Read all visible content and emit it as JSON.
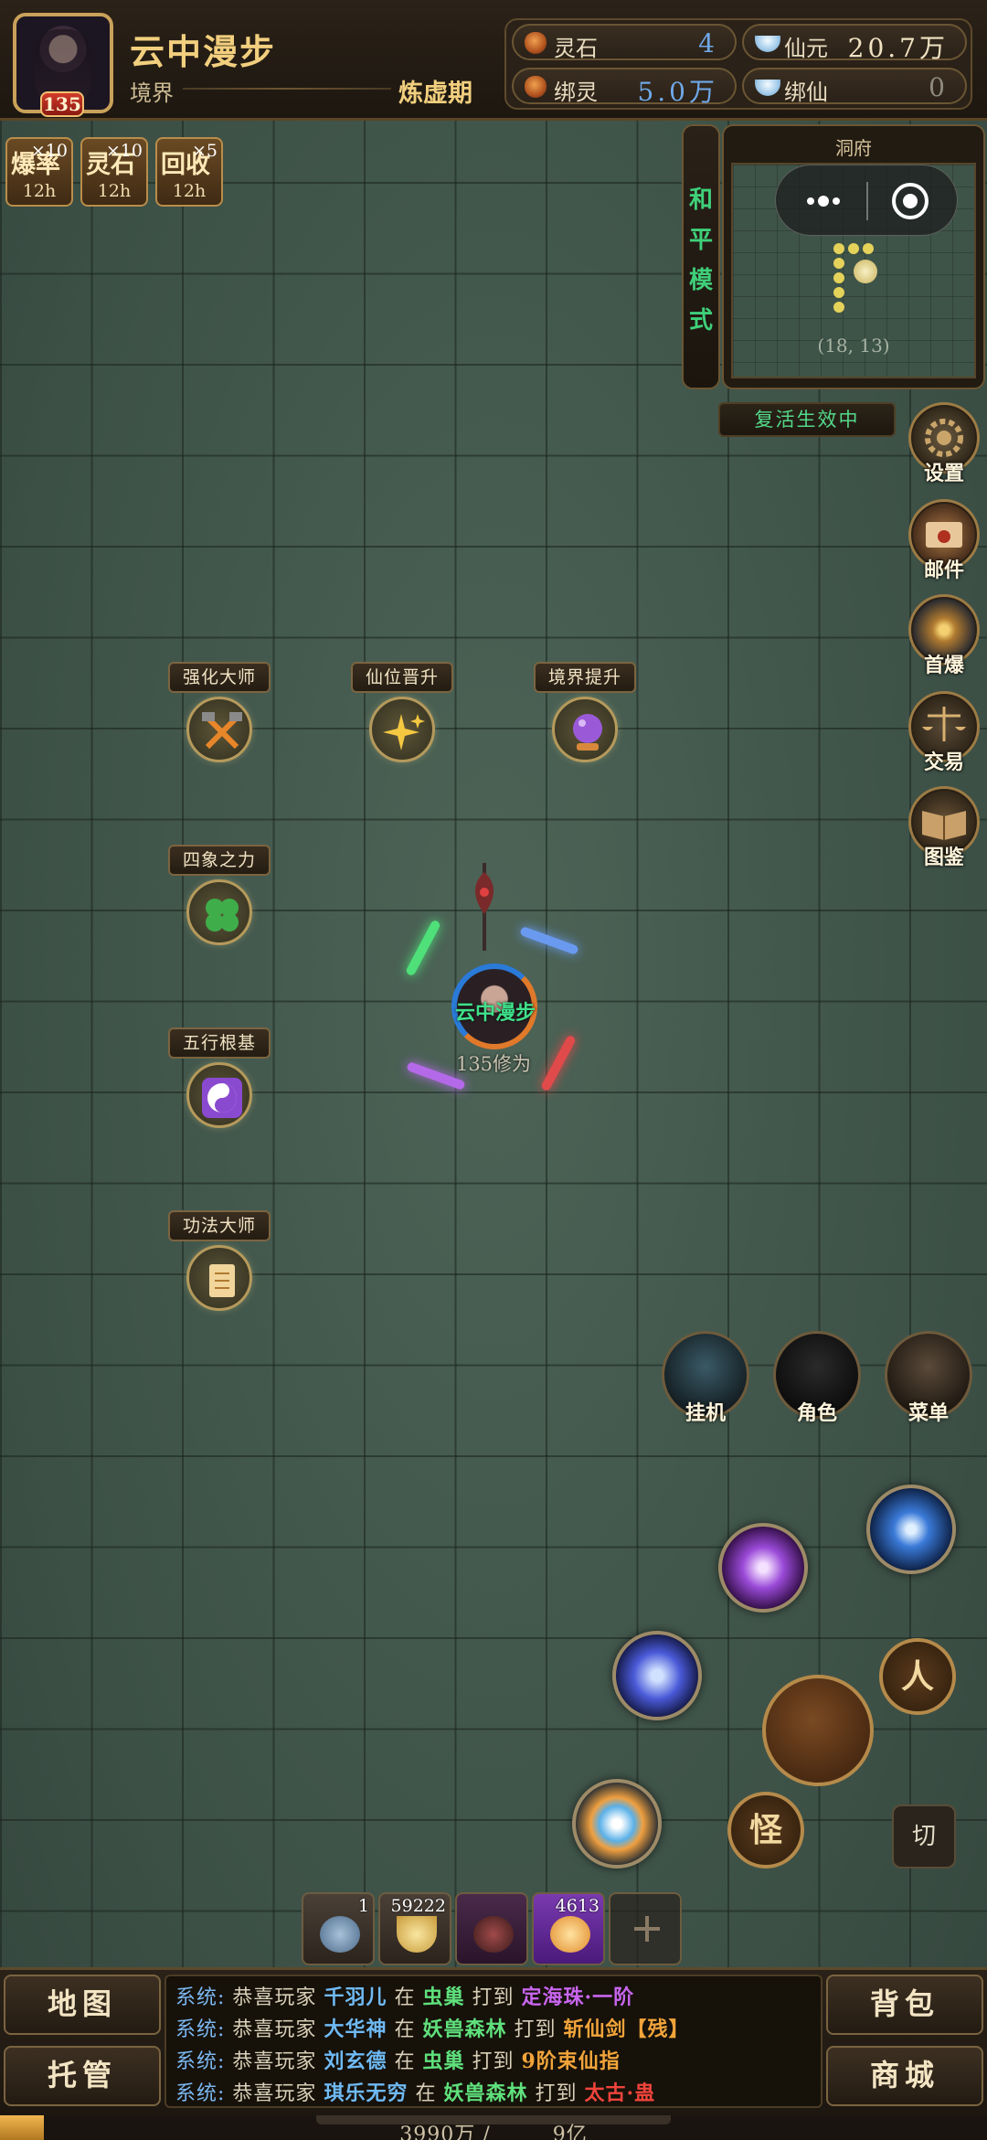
{
  "colors": {
    "accent_gold": "#f2cf7e",
    "peace_green": "#3fd07a",
    "chat_system_blue": "#7bb7f0",
    "player_name_green": "#3fe08a"
  },
  "header": {
    "player_name": "云中漫步",
    "level": "135",
    "realm_label": "境界",
    "realm_value": "炼虚期"
  },
  "currencies": [
    {
      "name": "灵石",
      "value": "4",
      "icon": "spirit-stone-icon",
      "value_color": "#6fa8e8"
    },
    {
      "name": "仙元",
      "value": "20.7万",
      "icon": "silver-ingot-icon",
      "value_color": "#f0e2c2"
    },
    {
      "name": "绑灵",
      "value": "5.0万",
      "icon": "spirit-stone-icon",
      "value_color": "#6fa8e8"
    },
    {
      "name": "绑仙",
      "value": "0",
      "icon": "silver-ingot-icon",
      "value_color": "#f0e2c2"
    }
  ],
  "buffs": [
    {
      "name": "爆率",
      "count": "×10",
      "time": "12h"
    },
    {
      "name": "灵石",
      "count": "×10",
      "time": "12h"
    },
    {
      "name": "回收",
      "count": "×5",
      "time": "12h"
    }
  ],
  "peace_mode": [
    "和",
    "平",
    "模",
    "式"
  ],
  "minimap": {
    "title": "洞府",
    "coords": "(18, 13)"
  },
  "revive_status": "复活生效中",
  "side_buttons": [
    "设置",
    "邮件",
    "首爆",
    "交易",
    "图鉴"
  ],
  "npcs": [
    {
      "label": "强化大师",
      "icon": "crossed-hammers-icon"
    },
    {
      "label": "仙位晋升",
      "icon": "sparkles-icon"
    },
    {
      "label": "境界提升",
      "icon": "crystal-ball-icon"
    },
    {
      "label": "四象之力",
      "icon": "four-leaf-clover-icon"
    },
    {
      "label": "五行根基",
      "icon": "yin-yang-icon"
    },
    {
      "label": "功法大师",
      "icon": "scroll-icon"
    }
  ],
  "player": {
    "name": "云中漫步",
    "power": "135修为"
  },
  "actions": [
    "挂机",
    "角色",
    "菜单"
  ],
  "combat": {
    "person_label": "人",
    "monster_label": "怪",
    "switch_label": "切"
  },
  "quick_items": [
    {
      "count": "1",
      "icon": "rune-stone-icon"
    },
    {
      "count": "59222",
      "icon": "gold-ingot-icon"
    },
    {
      "count": "",
      "icon": "dark-orb-icon"
    },
    {
      "count": "4613",
      "icon": "golden-treasure-icon"
    }
  ],
  "bottom": {
    "map_button": "地图",
    "auto_button": "托管",
    "bag_button": "背包",
    "shop_button": "商城"
  },
  "chat": [
    {
      "prefix": "系统:",
      "text1": "恭喜玩家",
      "player": "千羽儿",
      "in": "在",
      "map": "虫巢",
      "hit": "打到",
      "item": "定海珠·一阶",
      "item_color": "purple"
    },
    {
      "prefix": "系统:",
      "text1": "恭喜玩家",
      "player": "大华神",
      "in": "在",
      "map": "妖兽森林",
      "hit": "打到",
      "item": "斩仙剑【残】",
      "item_color": "orange"
    },
    {
      "prefix": "系统:",
      "text1": "恭喜玩家",
      "player": "刘玄德",
      "in": "在",
      "map": "虫巢",
      "hit": "打到",
      "item": "9阶束仙指",
      "item_color": "orange"
    },
    {
      "prefix": "系统:",
      "text1": "恭喜玩家",
      "player": "琪乐无穷",
      "in": "在",
      "map": "妖兽森林",
      "hit": "打到",
      "item": "太古·蛊",
      "item_color": "red"
    }
  ],
  "exp": {
    "current": "3990万",
    "separator": "/",
    "max": "9亿",
    "progress": 0.044
  }
}
